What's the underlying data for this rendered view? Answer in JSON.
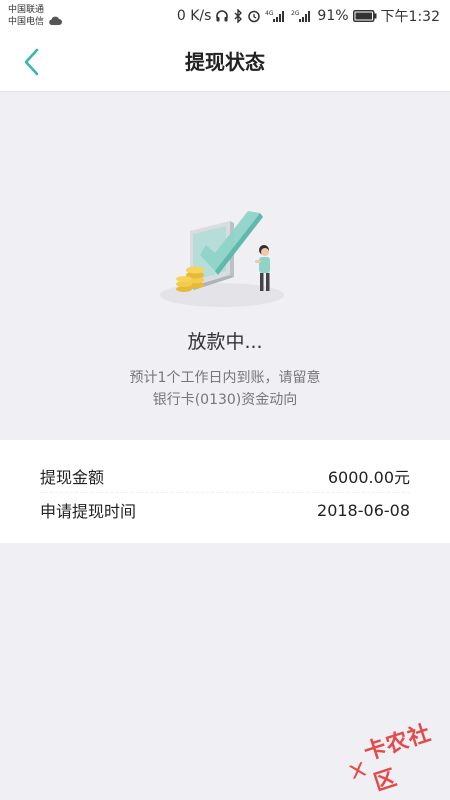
{
  "status_bar": {
    "carrier1": "中国联通",
    "carrier2": "中国电信",
    "net_speed": "0 K/s",
    "signal1_tag": "4G",
    "signal2_tag": "2G",
    "battery": "91%",
    "time": "下午1:32"
  },
  "header": {
    "title": "提现状态"
  },
  "status": {
    "title": "放款中...",
    "desc_line1": "预计1个工作日内到账，请留意",
    "desc_line2": "银行卡(0130)资金动向"
  },
  "details": {
    "amount_label": "提现金额",
    "amount_value": "6000.00元",
    "time_label": "申请提现时间",
    "time_value": "2018-06-08"
  },
  "watermark": "卡农社区",
  "colors": {
    "accent": "#3ab5b0",
    "background": "#efeff4",
    "watermark": "#e34a4a"
  }
}
